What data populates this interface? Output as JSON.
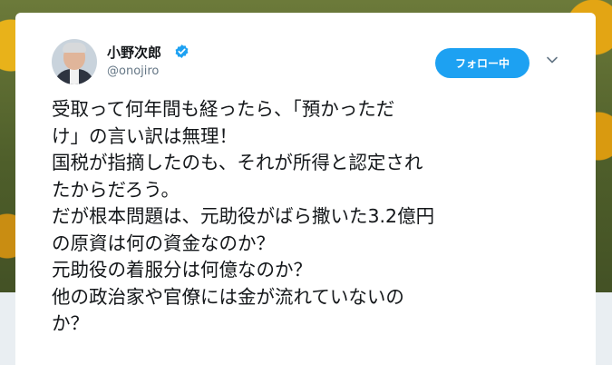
{
  "user": {
    "display_name": "小野次郎",
    "handle": "@onojiro",
    "verified": true
  },
  "follow_button": {
    "label": "フォロー中"
  },
  "icons": {
    "verified": "verified-badge-icon",
    "menu": "chevron-down-icon"
  },
  "colors": {
    "accent": "#1da1f2",
    "text": "#14171a",
    "secondary_text": "#657786"
  },
  "tweet": {
    "lines": [
      "受取って何年間も経ったら、「預かっただ",
      "け」の言い訳は無理！",
      "国税が指摘したのも、それが所得と認定され",
      "たからだろう。",
      "だが根本問題は、元助役がばら撒いた3.2億円",
      "の原資は何の資金なのか？",
      "元助役の着服分は何億なのか？",
      "他の政治家や官僚には金が流れていないの",
      "か？"
    ]
  }
}
